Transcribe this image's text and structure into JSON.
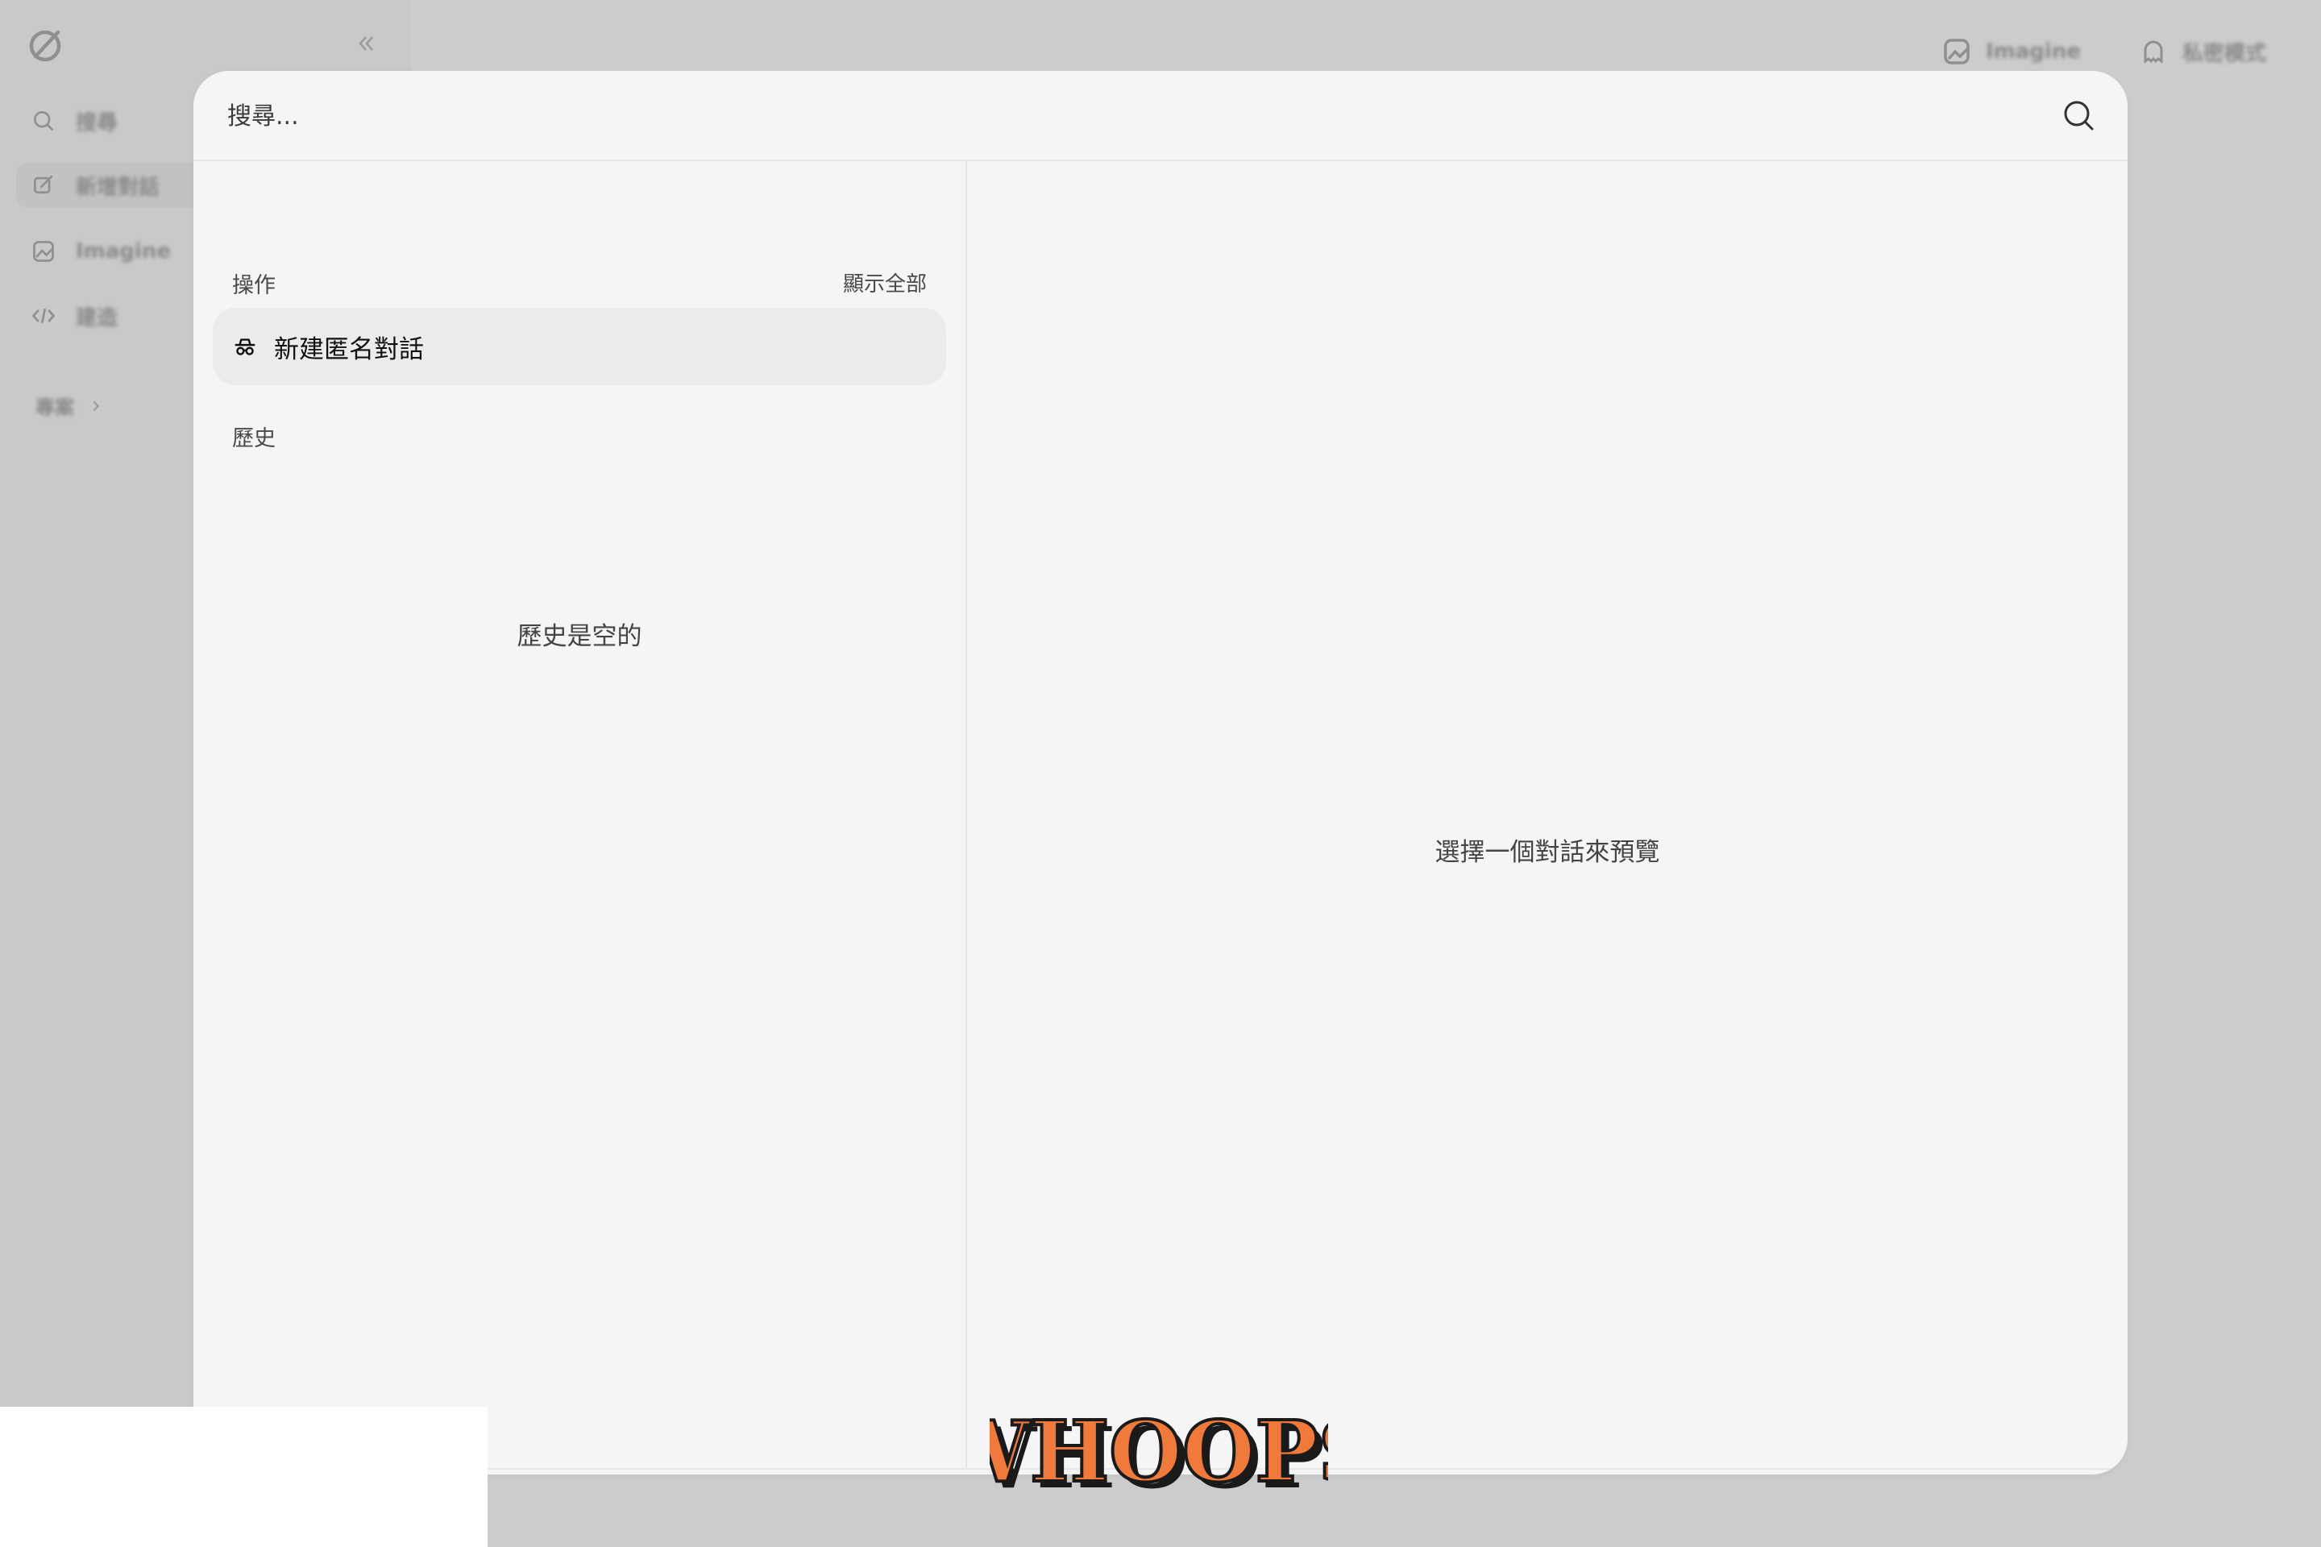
{
  "background": {
    "sidebar": {
      "nav_items": [
        {
          "label": "搜尋",
          "icon": "search-icon"
        },
        {
          "label": "新增對話",
          "icon": "edit-icon"
        },
        {
          "label": "Imagine",
          "icon": "image-icon"
        },
        {
          "label": "建造",
          "icon": "code-icon"
        }
      ],
      "projects_label": "專案"
    },
    "top_bar": {
      "imagine_label": "Imagine",
      "private_mode_label": "私密模式"
    }
  },
  "modal": {
    "search": {
      "placeholder": "搜尋..."
    },
    "actions": {
      "title": "操作",
      "show_all_label": "顯示全部",
      "items": [
        {
          "label": "新建匿名對話",
          "icon": "incognito-icon"
        }
      ]
    },
    "history": {
      "title": "歷史",
      "empty_text": "歷史是空的"
    },
    "preview": {
      "empty_text": "選擇一個對話來預覽"
    }
  },
  "overlay": {
    "whoops_text": "WHOOPS",
    "colors": {
      "whoops_fill": "#f07a3c",
      "whoops_outline": "#1a1a1a"
    }
  }
}
